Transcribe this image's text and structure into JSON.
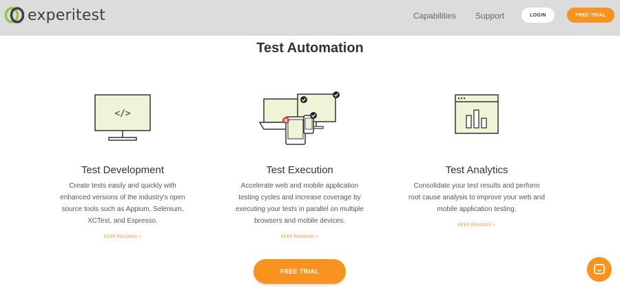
{
  "header": {
    "logo_text": "experitest",
    "nav": [
      "Capabilities",
      "Support"
    ],
    "login_label": "LOGIN",
    "free_trial_label": "FREE TRIAL"
  },
  "main": {
    "title": "Test Automation",
    "features": [
      {
        "title": "Test Development",
        "text": "Create tests easily and quickly with enhanced versions of the industry's open source tools such as Appium, Selenium, XCTest, and Espresso.",
        "link": "KEEP READING >",
        "icon": "code-monitor-icon"
      },
      {
        "title": "Test Execution",
        "text": "Accelerate web and mobile application testing cycles and increase coverage by executing your tests in parallel on multiple browsers and mobile devices.",
        "link": "KEEP READING >",
        "icon": "devices-icon"
      },
      {
        "title": "Test Analytics",
        "text": "Consolidate your test results and perform root cause analysis to improve your web and mobile application testing.",
        "link": "KEEP READING >",
        "icon": "analytics-window-icon"
      }
    ],
    "cta_label": "FREE TRIAL"
  },
  "colors": {
    "accent": "#f7931e",
    "header_bg": "#dcdcdc",
    "icon_fill": "#eef5d6"
  }
}
